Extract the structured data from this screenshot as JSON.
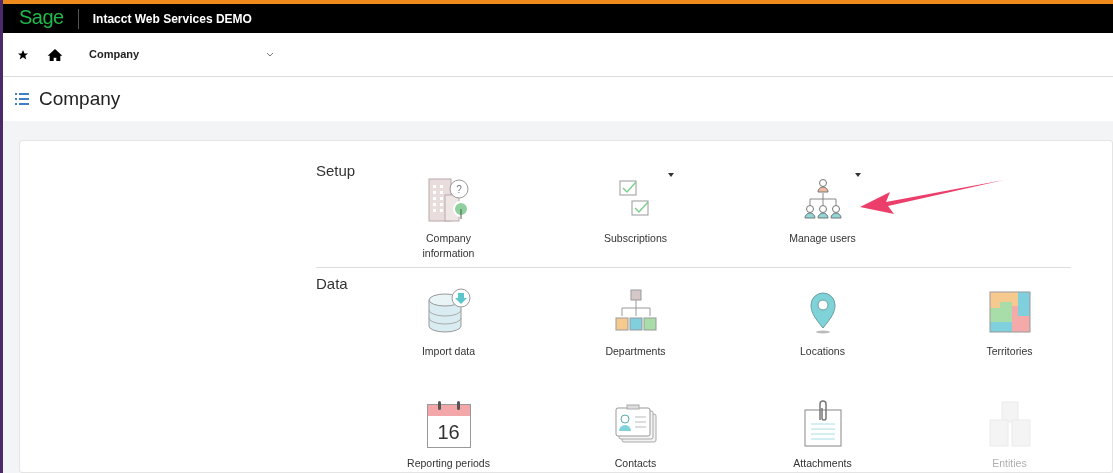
{
  "header": {
    "logo": "Sage",
    "title": "Intacct Web Services DEMO"
  },
  "nav": {
    "module": "Company"
  },
  "page_title": "Company",
  "sections": [
    {
      "title": "Setup",
      "items": [
        {
          "label": "Company information",
          "kind": "company",
          "badge": "?",
          "has_menu": false,
          "disabled": false
        },
        {
          "label": "Subscriptions",
          "kind": "subscriptions",
          "has_menu": true,
          "disabled": false
        },
        {
          "label": "Manage users",
          "kind": "users",
          "has_menu": true,
          "disabled": false
        }
      ]
    },
    {
      "title": "Data",
      "items": [
        {
          "label": "Import data",
          "kind": "import",
          "has_menu": false,
          "disabled": false
        },
        {
          "label": "Departments",
          "kind": "departments",
          "has_menu": false,
          "disabled": false
        },
        {
          "label": "Locations",
          "kind": "location",
          "has_menu": false,
          "disabled": false
        },
        {
          "label": "Territories",
          "kind": "territories",
          "has_menu": false,
          "disabled": false
        },
        {
          "label": "Reporting periods",
          "kind": "calendar",
          "day": "16",
          "has_menu": false,
          "disabled": false
        },
        {
          "label": "Contacts",
          "kind": "contacts",
          "has_menu": false,
          "disabled": false
        },
        {
          "label": "Attachments",
          "kind": "attachments",
          "has_menu": false,
          "disabled": false
        },
        {
          "label": "Entities",
          "kind": "entities",
          "has_menu": false,
          "disabled": true
        }
      ]
    }
  ]
}
